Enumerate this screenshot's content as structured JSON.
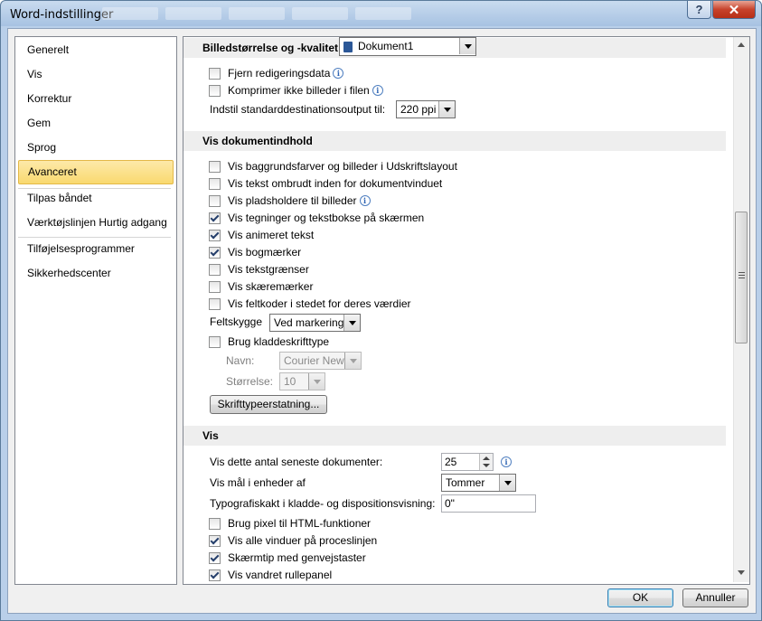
{
  "window": {
    "title": "Word-indstillinger",
    "help_label": "?",
    "close_label": "✕"
  },
  "nav": {
    "items": [
      "Generelt",
      "Vis",
      "Korrektur",
      "Gem",
      "Sprog",
      "Avanceret",
      "Tilpas båndet",
      "Værktøjslinjen Hurtig adgang",
      "Tilføjelsesprogrammer",
      "Sikkerhedscenter"
    ],
    "selected": "Avanceret"
  },
  "image_section": {
    "header": "Billedstørrelse og -kvalitet",
    "document": "Dokument1",
    "discard_edit": "Fjern redigeringsdata",
    "no_compress": "Komprimer ikke billeder i filen",
    "default_output_label": "Indstil standarddestinationsoutput til:",
    "default_output_value": "220 ppi"
  },
  "content_section": {
    "header": "Vis dokumentindhold",
    "options": [
      {
        "label": "Vis baggrundsfarver og billeder i Udskriftslayout",
        "checked": false
      },
      {
        "label": "Vis tekst ombrudt inden for dokumentvinduet",
        "checked": false
      },
      {
        "label": "Vis pladsholdere til billeder",
        "checked": false,
        "info": true
      },
      {
        "label": "Vis tegninger og tekstbokse på skærmen",
        "checked": true
      },
      {
        "label": "Vis animeret tekst",
        "checked": true
      },
      {
        "label": "Vis bogmærker",
        "checked": true
      },
      {
        "label": "Vis tekstgrænser",
        "checked": false
      },
      {
        "label": "Vis skæremærker",
        "checked": false
      },
      {
        "label": "Vis feltkoder i stedet for deres værdier",
        "checked": false
      }
    ],
    "field_shading_label": "Feltskygge",
    "field_shading_value": "Ved markering",
    "draft_font_label": "Brug kladdeskrifttype",
    "name_label": "Navn:",
    "name_value": "Courier New",
    "size_label": "Størrelse:",
    "size_value": "10",
    "font_sub_button": "Skrifttypeerstatning..."
  },
  "display_section": {
    "header": "Vis",
    "recent_docs_label": "Vis dette antal seneste dokumenter:",
    "recent_docs_value": "25",
    "units_label": "Vis mål i enheder af",
    "units_value": "Tommer",
    "style_area_label": "Typografiskakt i kladde- og dispositionsvisning:",
    "style_area_value": "0\"",
    "options": [
      {
        "label": "Brug pixel til HTML-funktioner",
        "checked": false
      },
      {
        "label": "Vis alle vinduer på proceslinjen",
        "checked": true
      },
      {
        "label": "Skærmtip med genvejstaster",
        "checked": true
      },
      {
        "label": "Vis vandret rullepanel",
        "checked": true
      }
    ]
  },
  "footer": {
    "ok": "OK",
    "cancel": "Annuller"
  },
  "colors": {
    "selection": "#f9d96f",
    "section_header": "#eeeeee",
    "title_bar": "#b9cfe9",
    "close": "#c7422b"
  },
  "icons": [
    "help-icon",
    "close-icon",
    "document-icon",
    "info-icon",
    "dropdown-arrow-icon",
    "checkbox-check-icon",
    "spinner-icon",
    "scroll-up-icon",
    "scroll-down-icon"
  ]
}
